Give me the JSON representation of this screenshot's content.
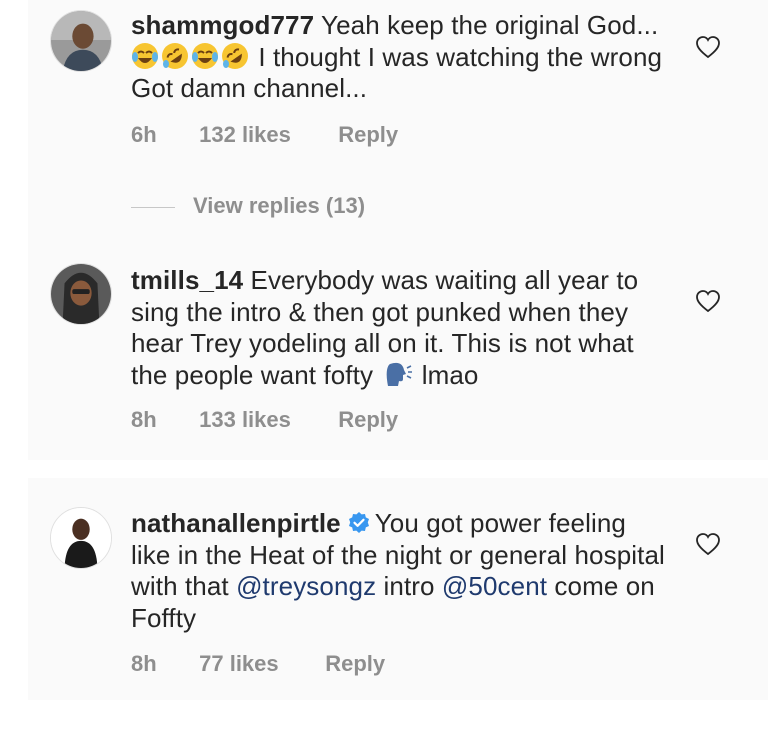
{
  "comments": [
    {
      "username": "shammgod777",
      "text_before_emoji": "Yeah keep the original God...",
      "emojis": [
        "face-with-tears-of-joy",
        "rolling-on-floor-laughing",
        "face-with-tears-of-joy",
        "rolling-on-floor-laughing"
      ],
      "text_after_emoji": "I thought I was watching the wrong Got damn channel...",
      "time": "6h",
      "likes": "132 likes",
      "reply_label": "Reply",
      "liked": false
    },
    {
      "username": "tmills_14",
      "text": "Everybody was waiting all year to sing the intro & then got punked when they hear Trey yodeling all on it. This is not what the people want fofty",
      "emoji": "speaking-head",
      "text_after_emoji": "lmao",
      "time": "8h",
      "likes": "133 likes",
      "reply_label": "Reply",
      "liked": false
    },
    {
      "username": "nathanallenpirtle",
      "verified": true,
      "text_part1": "You got power feeling like in the Heat of the night or general hospital with that",
      "mention1": "@treysongz",
      "text_part2": "intro",
      "mention2": "@50cent",
      "text_part3": "come on Foffty",
      "time": "8h",
      "likes": "77 likes",
      "reply_label": "Reply",
      "liked": false
    }
  ],
  "view_replies": "View replies (13)",
  "colors": {
    "text": "#262626",
    "secondary": "#8e8e8e",
    "mention": "#1f3a6e",
    "verified": "#3897f0",
    "panel_bg": "#fafafa"
  }
}
